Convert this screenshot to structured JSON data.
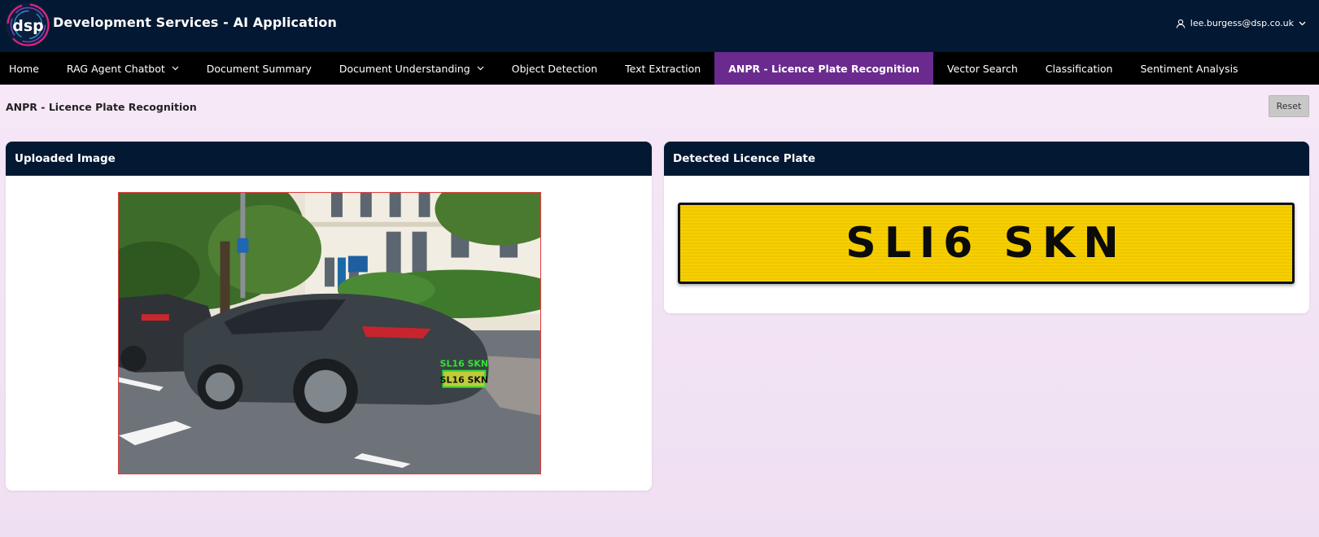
{
  "header": {
    "logo_text": "dsp",
    "app_title": "Development Services - AI Application",
    "user_email": "lee.burgess@dsp.co.uk"
  },
  "nav": {
    "items": [
      {
        "label": "Home",
        "has_dropdown": false,
        "active": false
      },
      {
        "label": "RAG Agent Chatbot",
        "has_dropdown": true,
        "active": false
      },
      {
        "label": "Document Summary",
        "has_dropdown": false,
        "active": false
      },
      {
        "label": "Document Understanding",
        "has_dropdown": true,
        "active": false
      },
      {
        "label": "Object Detection",
        "has_dropdown": false,
        "active": false
      },
      {
        "label": "Text Extraction",
        "has_dropdown": false,
        "active": false
      },
      {
        "label": "ANPR - Licence Plate Recognition",
        "has_dropdown": false,
        "active": true
      },
      {
        "label": "Vector Search",
        "has_dropdown": false,
        "active": false
      },
      {
        "label": "Classification",
        "has_dropdown": false,
        "active": false
      },
      {
        "label": "Sentiment Analysis",
        "has_dropdown": false,
        "active": false
      }
    ]
  },
  "page": {
    "title": "ANPR - Licence Plate Recognition",
    "reset_label": "Reset"
  },
  "uploaded": {
    "title": "Uploaded Image",
    "detection_label": "SL16 SKN",
    "car_plate": "SL16 SKN"
  },
  "detected": {
    "title": "Detected Licence Plate",
    "plate_text": "SLI6 SKN"
  },
  "colors": {
    "header_bg": "#031832",
    "nav_bg": "#000000",
    "active_tab": "#6a2a8e",
    "plate_yellow": "#f7cf00",
    "detection_green": "#2ee82e",
    "image_border": "#e13b3b"
  }
}
